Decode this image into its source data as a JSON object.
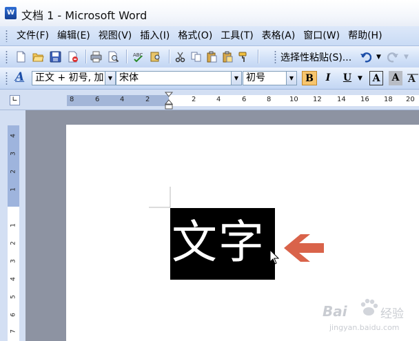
{
  "window": {
    "title": "文档 1 - Microsoft Word",
    "app_icon_text": "W"
  },
  "menubar": {
    "items": [
      "文件(F)",
      "编辑(E)",
      "视图(V)",
      "插入(I)",
      "格式(O)",
      "工具(T)",
      "表格(A)",
      "窗口(W)",
      "帮助(H)"
    ]
  },
  "toolbar": {
    "paste_special_label": "选择性粘贴(S)...",
    "icons": [
      "new-document-icon",
      "open-folder-icon",
      "save-icon",
      "permission-icon",
      "print-icon",
      "print-preview-icon",
      "spelling-icon",
      "research-icon",
      "cut-icon",
      "copy-icon",
      "paste-icon",
      "paste-special-icon",
      "format-painter-icon",
      "undo-icon",
      "redo-icon"
    ]
  },
  "formatting": {
    "style_value": "正文 + 初号, 加",
    "font_value": "宋体",
    "size_value": "初号",
    "bold_label": "B",
    "italic_label": "I",
    "underline_label": "U",
    "char_border_label": "A",
    "char_shading_label": "A",
    "style_icon_label": "A"
  },
  "ruler": {
    "horizontal_numbers": [
      "8",
      "6",
      "4",
      "2",
      "2",
      "4",
      "6",
      "8",
      "10",
      "12",
      "14",
      "16",
      "18",
      "20"
    ],
    "vertical_numbers": [
      "4",
      "3",
      "2",
      "1",
      "1",
      "1",
      "2",
      "3",
      "4",
      "5",
      "6",
      "7",
      "8"
    ]
  },
  "document": {
    "text": "文字"
  },
  "watermark": {
    "brand": "Bai",
    "brand2": "经验",
    "url": "jingyan.baidu.com"
  },
  "colors": {
    "highlight_button": "#f7c56d",
    "arrow": "#d9634a",
    "selection": "#000000"
  }
}
